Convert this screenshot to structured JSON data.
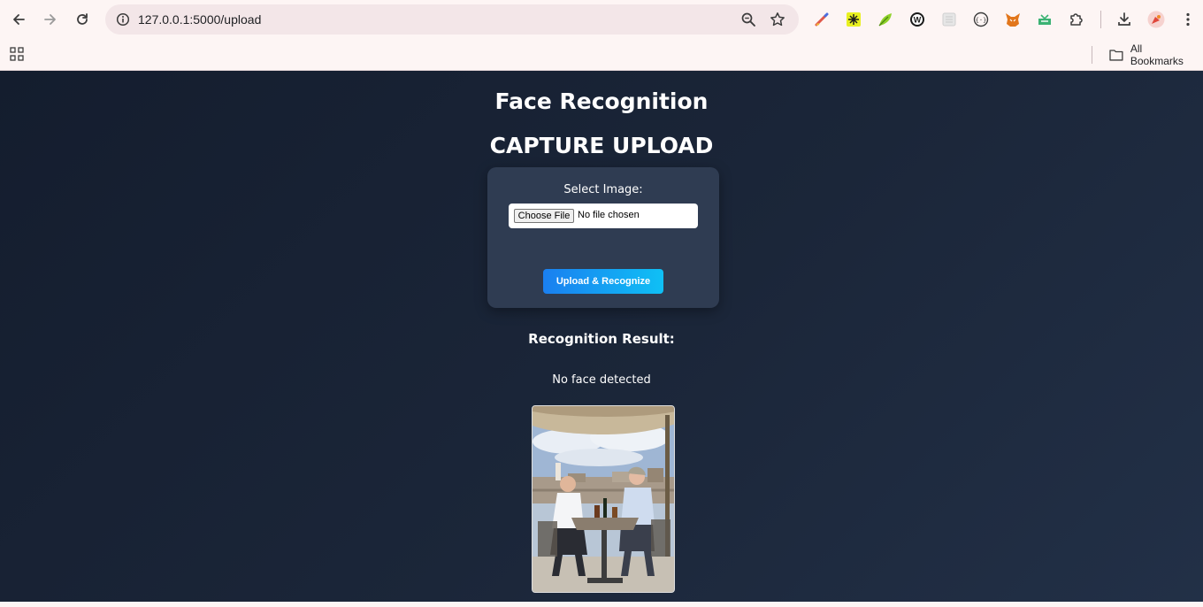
{
  "browser": {
    "url": "127.0.0.1:5000/upload",
    "bookmarks_label": "All Bookmarks",
    "icons": [
      "back-icon",
      "forward-icon",
      "reload-icon",
      "site-info-icon",
      "zoom-icon",
      "star-icon",
      "pen-extension-icon",
      "sparkle-extension-icon",
      "leaf-extension-icon",
      "w-extension-icon",
      "grey-extension-icon",
      "bracket-extension-icon",
      "fox-extension-icon",
      "download-extension-icon",
      "puzzle-icon",
      "download-icon",
      "profile-avatar-icon",
      "menu-icon",
      "apps-grid-icon",
      "folder-icon"
    ]
  },
  "page": {
    "title": "Face Recognition",
    "subtitle": "CAPTURE UPLOAD",
    "form": {
      "label": "Select Image:",
      "choose_file": "Choose File",
      "no_file": "No file chosen",
      "submit": "Upload & Recognize"
    },
    "result": {
      "heading": "Recognition Result:",
      "message": "No face detected"
    }
  },
  "colors": {
    "chrome_bg": "#fdf5f4",
    "page_bg_start": "#141d2e",
    "page_bg_end": "#223047",
    "card_bg": "#2f3c52",
    "button_start": "#1a7ff0",
    "button_end": "#0fc0f5"
  }
}
